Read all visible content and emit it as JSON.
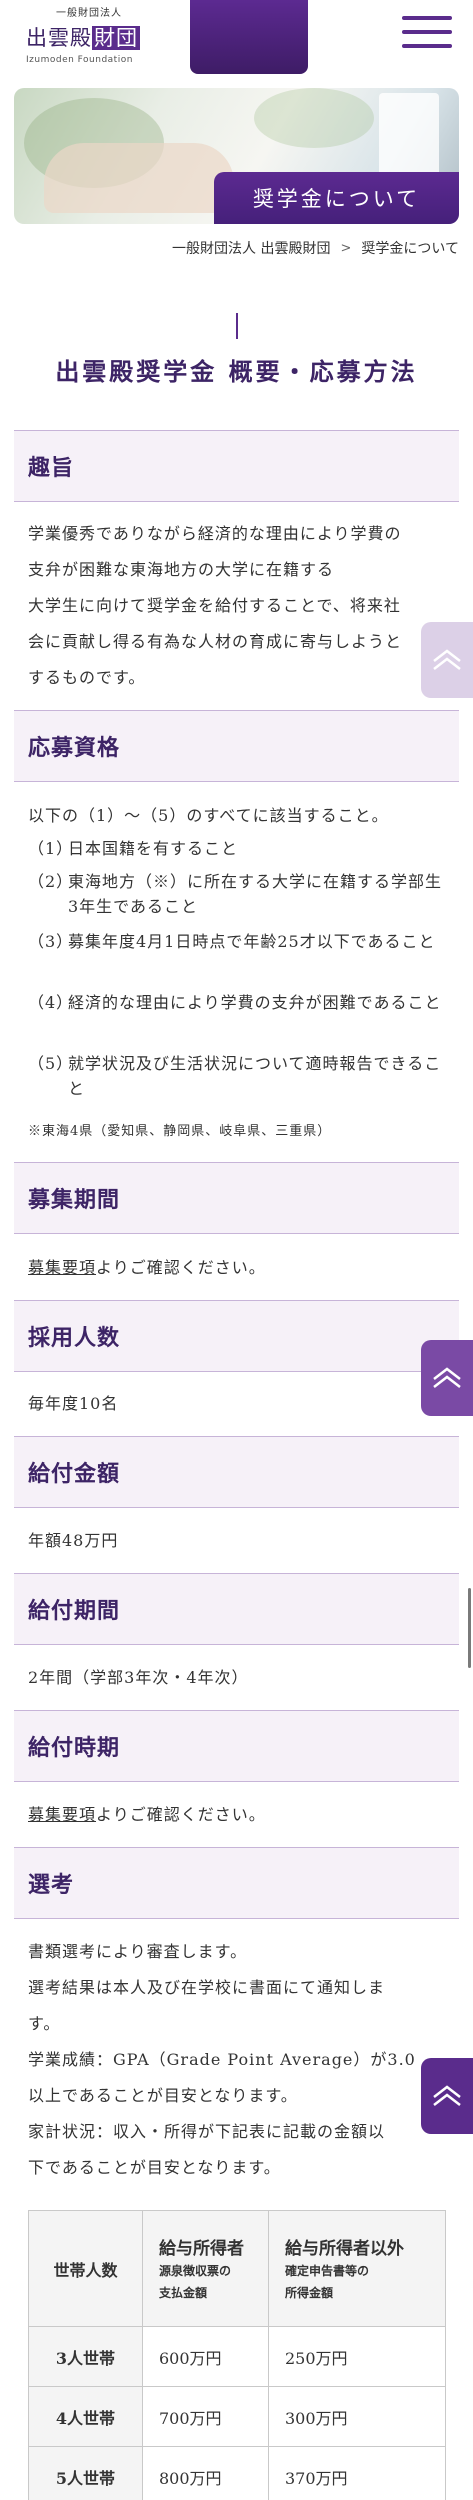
{
  "header": {
    "logo_small": "一般財団法人",
    "logo_main_a": "出雲殿",
    "logo_main_b": "財団",
    "logo_sub": "Izumoden Foundation"
  },
  "hero": {
    "label": "奨学金について"
  },
  "breadcrumb": {
    "home": "一般財団法人 出雲殿財団",
    "current": "奨学金について"
  },
  "page_title": "出雲殿奨学金 概要・応募方法",
  "sections": {
    "shushi": {
      "heading": "趣旨",
      "lines": [
        "学業優秀でありながら経済的な理由により学費の",
        "支弁が困難な東海地方の大学に在籍する",
        "大学生に向けて奨学金を給付することで、将来社",
        "会に貢献し得る有為な人材の育成に寄与しようと",
        "するものです。"
      ]
    },
    "shikaku": {
      "heading": "応募資格",
      "intro": "以下の（1）～（5）のすべてに該当すること。",
      "items": [
        {
          "num": "（1）",
          "text": "日本国籍を有すること"
        },
        {
          "num": "（2）",
          "text": "東海地方（※）に所在する大学に在籍する学部生3年生であること"
        },
        {
          "num": "（3）",
          "text": "募集年度4月1日時点で年齢25才以下であること"
        },
        {
          "num": "（4）",
          "text": "経済的な理由により学費の支弁が困難であること"
        },
        {
          "num": "（5）",
          "text": "就学状況及び生活状況について適時報告できること"
        }
      ],
      "note": "※東海4県（愛知県、静岡県、岐阜県、三重県）"
    },
    "kikan": {
      "heading": "募集期間",
      "link": "募集要項",
      "text": "よりご確認ください。"
    },
    "ninzu": {
      "heading": "採用人数",
      "text": "毎年度10名"
    },
    "kingaku": {
      "heading": "給付金額",
      "text": "年額48万円"
    },
    "kyufu_kikan": {
      "heading": "給付期間",
      "text": "2年間（学部3年次・4年次）"
    },
    "jiki": {
      "heading": "給付時期",
      "link": "募集要項",
      "text": "よりご確認ください。"
    },
    "senko": {
      "heading": "選考",
      "lines": [
        "書類選考により審査します。",
        "選考結果は本人及び在学校に書面にて通知しま",
        "す。",
        "学業成績：GPA（Grade Point Average）が3.0",
        "以上であることが目安となります。",
        "家計状況：収入・所得が下記表に記載の金額以",
        "下であることが目安となります。"
      ]
    }
  },
  "table": {
    "headers": {
      "col1": "世帯人数",
      "col2_title": "給与所得者",
      "col2_sub1": "源泉徴収票の",
      "col2_sub2": "支払金額",
      "col3_title": "給与所得者以外",
      "col3_sub1": "確定申告書等の",
      "col3_sub2": "所得金額"
    },
    "rows": [
      {
        "size": "3人世帯",
        "salary": "600万円",
        "other": "250万円"
      },
      {
        "size": "4人世帯",
        "salary": "700万円",
        "other": "300万円"
      },
      {
        "size": "5人世帯",
        "salary": "800万円",
        "other": "370万円"
      }
    ]
  },
  "colors": {
    "accent": "#5a2c8c",
    "section_bg": "#f6f1f8"
  },
  "icons": {
    "menu": "hamburger-icon",
    "pagetop": "chevron-up-icon"
  }
}
